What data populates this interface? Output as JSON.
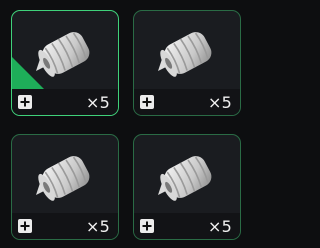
{
  "inventory": {
    "slots": [
      {
        "item_icon": "cloth-roll-icon",
        "quantity": "×5",
        "add_icon": "plus-icon",
        "accent": "#1fbf5f",
        "selected": true
      },
      {
        "item_icon": "cloth-roll-icon",
        "quantity": "×5",
        "add_icon": "plus-icon",
        "accent": "#1fbf5f",
        "selected": false
      },
      {
        "item_icon": "cloth-roll-icon",
        "quantity": "×5",
        "add_icon": "plus-icon",
        "accent": "#1fbf5f",
        "selected": false
      },
      {
        "item_icon": "cloth-roll-icon",
        "quantity": "×5",
        "add_icon": "plus-icon",
        "accent": "#1fbf5f",
        "selected": false
      }
    ]
  }
}
